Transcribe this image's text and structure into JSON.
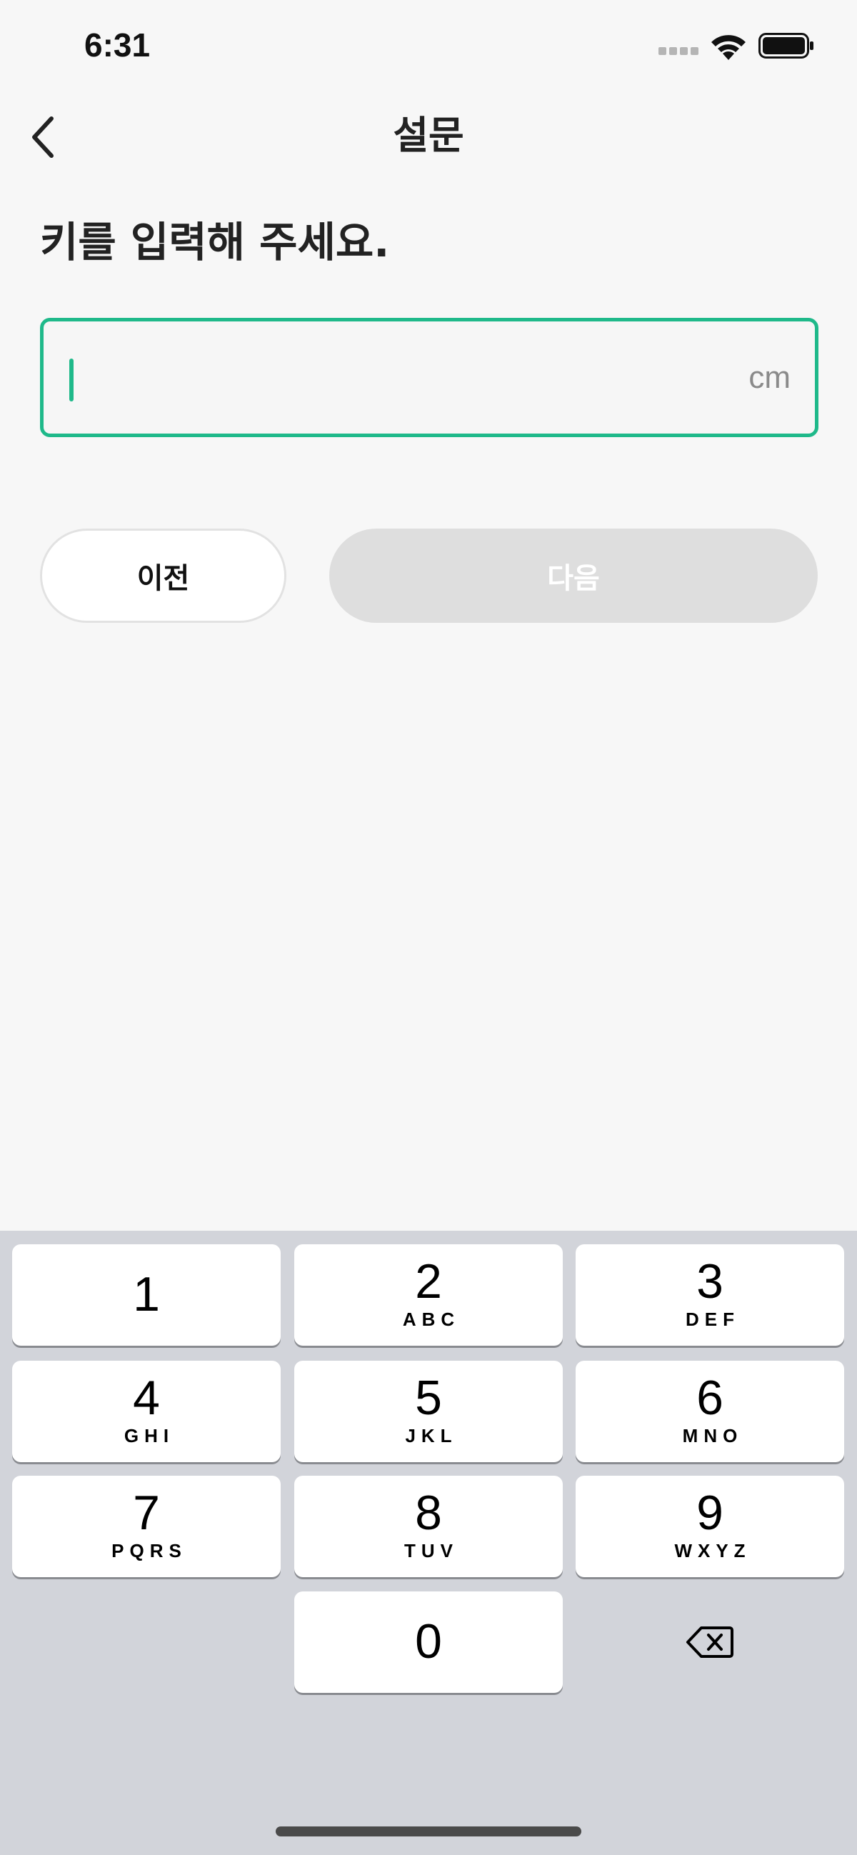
{
  "status_bar": {
    "time": "6:31"
  },
  "nav": {
    "title": "설문"
  },
  "question": {
    "title": "키를 입력해 주세요."
  },
  "input": {
    "value": "",
    "unit": "cm"
  },
  "buttons": {
    "prev_label": "이전",
    "next_label": "다음"
  },
  "keypad": {
    "keys": [
      {
        "digit": "1",
        "letters": ""
      },
      {
        "digit": "2",
        "letters": "ABC"
      },
      {
        "digit": "3",
        "letters": "DEF"
      },
      {
        "digit": "4",
        "letters": "GHI"
      },
      {
        "digit": "5",
        "letters": "JKL"
      },
      {
        "digit": "6",
        "letters": "MNO"
      },
      {
        "digit": "7",
        "letters": "PQRS"
      },
      {
        "digit": "8",
        "letters": "TUV"
      },
      {
        "digit": "9",
        "letters": "WXYZ"
      },
      {
        "digit": "0",
        "letters": ""
      }
    ]
  },
  "colors": {
    "accent": "#1fb98a",
    "next_disabled_bg": "#dedede",
    "keypad_bg": "#d2d4da"
  },
  "icons": {
    "back": "chevron-left-icon",
    "delete": "backspace-icon",
    "wifi": "wifi-icon",
    "battery": "battery-icon",
    "signal": "signal-icon"
  }
}
